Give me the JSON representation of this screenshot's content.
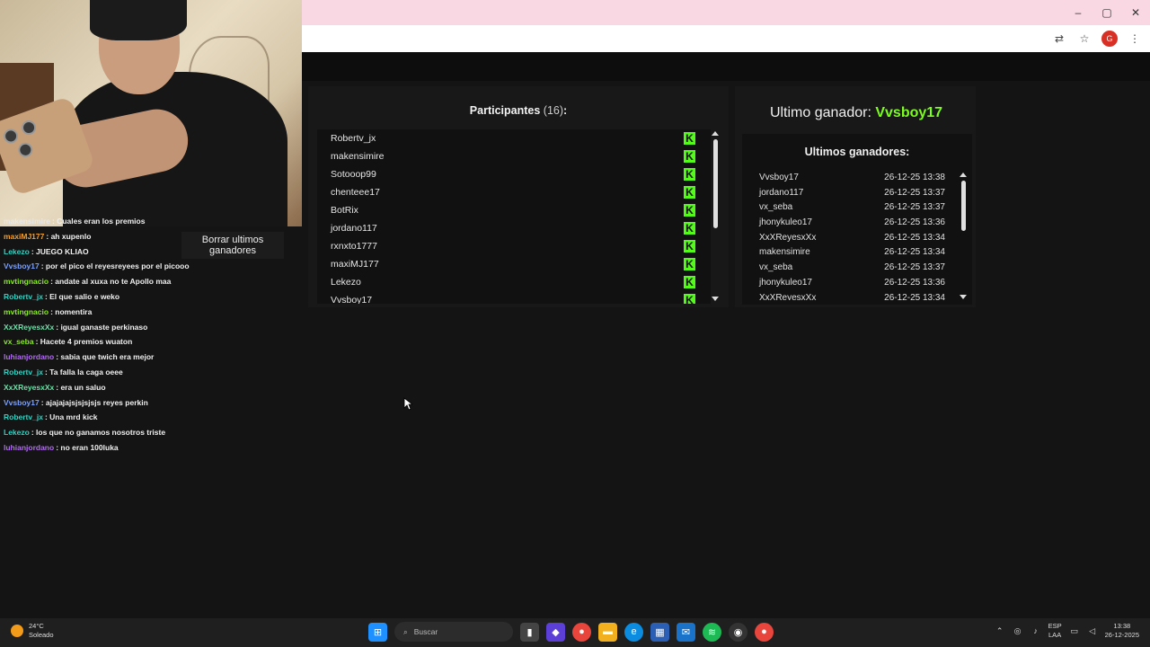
{
  "browser": {
    "window_controls": {
      "minimize": "–",
      "maximize": "▢",
      "close": "✕"
    },
    "toolbar_icons": [
      "translate-icon",
      "star-icon",
      "profile-icon",
      "menu-icon"
    ],
    "profile_letter": "G"
  },
  "chat": {
    "clear_button_label": "Borrar ultimos ganadores",
    "messages": [
      {
        "user": "makensimire",
        "text": ": Cuales eran los premios",
        "color": "#e8e8e8"
      },
      {
        "user": "maxiMJ177",
        "text": ": ah xupenlo",
        "color": "#f0a030"
      },
      {
        "user": "Lekezo",
        "text": ": JUEGO KLIAO",
        "color": "#2ed3c4"
      },
      {
        "user": "Vvsboy17",
        "text": ": por el pico el reyesreyees por el picooo",
        "color": "#7aa0ff"
      },
      {
        "user": "mvtingnacio",
        "text": ": andate al xuxa no te Apollo maa",
        "color": "#8ce82c"
      },
      {
        "user": "Robertv_jx",
        "text": ": El que salio e weko",
        "color": "#2ed3c4"
      },
      {
        "user": "mvtingnacio",
        "text": ": nomentira",
        "color": "#8ce82c"
      },
      {
        "user": "XxXReyesxXx",
        "text": ": igual ganaste perkinaso",
        "color": "#6de0a8"
      },
      {
        "user": "vx_seba",
        "text": ": Hacete 4 premios wuaton",
        "color": "#8ce82c"
      },
      {
        "user": "luhianjordano",
        "text": ": sabia que twich era mejor",
        "color": "#b06cf0"
      },
      {
        "user": "Robertv_jx",
        "text": ": Ta falla la caga oeee",
        "color": "#2ed3c4"
      },
      {
        "user": "XxXReyesxXx",
        "text": ": era un saluo",
        "color": "#6de0a8"
      },
      {
        "user": "Vvsboy17",
        "text": ": ajajajajsjsjsjsjs reyes perkin",
        "color": "#7aa0ff"
      },
      {
        "user": "Robertv_jx",
        "text": ": Una mrd kick",
        "color": "#2ed3c4"
      },
      {
        "user": "Lekezo",
        "text": ": los que no ganamos nosotros triste",
        "color": "#2ed3c4"
      },
      {
        "user": "luhianjordano",
        "text": ": no eran 100luka",
        "color": "#b06cf0"
      }
    ]
  },
  "participants": {
    "title": "Participantes",
    "count": "(16)",
    "colon": ":",
    "platform_icon": "K",
    "names": [
      "Robertv_jx",
      "makensimire",
      "Sotooop99",
      "chenteee17",
      "BotRix",
      "jordano117",
      "rxnxto1777",
      "maxiMJ177",
      "Lekezo",
      "Vvsboy17"
    ],
    "scroll_fraction": 0.55
  },
  "winners": {
    "last_winner_label": "Ultimo ganador:",
    "last_winner_name": "Vvsboy17",
    "subtitle": "Ultimos ganadores:",
    "rows": [
      {
        "name": "Vvsboy17",
        "time": "26-12-25 13:38"
      },
      {
        "name": "jordano117",
        "time": "26-12-25 13:37"
      },
      {
        "name": "vx_seba",
        "time": "26-12-25 13:37"
      },
      {
        "name": "jhonykuleo17",
        "time": "26-12-25 13:36"
      },
      {
        "name": "XxXReyesxXx",
        "time": "26-12-25 13:34"
      },
      {
        "name": "makensimire",
        "time": "26-12-25 13:34"
      },
      {
        "name": "vx_seba",
        "time": "26-12-25 13:37"
      },
      {
        "name": "jhonykuleo17",
        "time": "26-12-25 13:36"
      },
      {
        "name": "XxXReyesxXx",
        "time": "26-12-25 13:34"
      }
    ],
    "scroll_fraction": 0.4
  },
  "taskbar": {
    "weather_temp": "24°C",
    "weather_desc": "Soleado",
    "search_placeholder": "Buscar",
    "lang_top": "ESP",
    "lang_bottom": "LAA",
    "time": "13:38",
    "date": "26-12-2025",
    "apps": [
      "windows-start-icon",
      "search-icon",
      "file-explorer-icon",
      "store-icon",
      "chrome-icon",
      "folder-icon",
      "edge-icon",
      "calculator-icon",
      "outlook-icon",
      "spotify-icon",
      "obs-icon",
      "chrome-alt-icon"
    ]
  }
}
